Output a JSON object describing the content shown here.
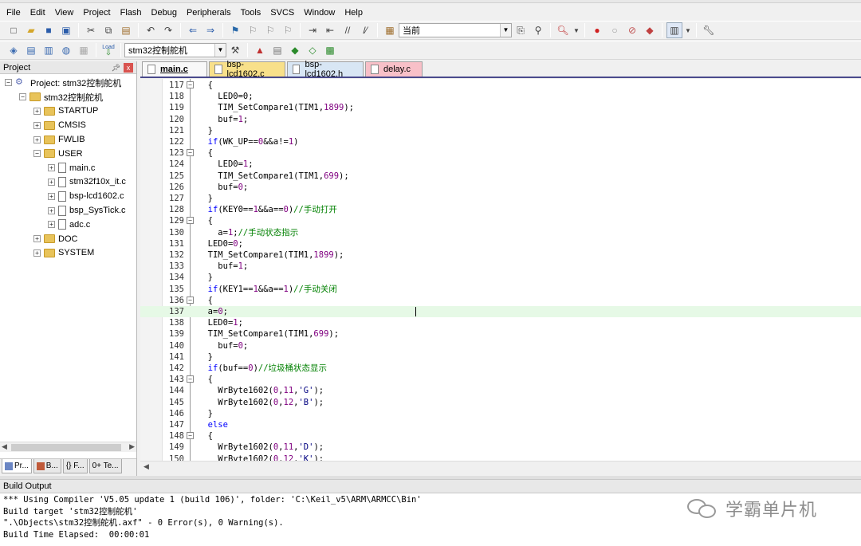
{
  "menu": [
    "File",
    "Edit",
    "View",
    "Project",
    "Flash",
    "Debug",
    "Peripherals",
    "Tools",
    "SVCS",
    "Window",
    "Help"
  ],
  "toolbar1": {
    "find_value": "当前",
    "icons": [
      "new-file-icon",
      "open-folder-icon",
      "save-icon",
      "save-all-icon",
      "cut-icon",
      "copy-icon",
      "paste-icon",
      "undo-icon",
      "redo-icon",
      "nav-back-icon",
      "nav-forward-icon",
      "bookmark-icon",
      "prev-bookmark-icon",
      "next-bookmark-icon",
      "clear-bookmarks-icon",
      "indent-icon",
      "unindent-icon",
      "comment-icon",
      "uncomment-icon",
      "find-in-files-icon"
    ]
  },
  "toolbar2": {
    "load_label": "Load",
    "target_value": "stm32控制舵机"
  },
  "project_panel": {
    "title": "Project",
    "root": "Project: stm32控制舵机",
    "target": "stm32控制舵机",
    "groups": {
      "startup": "STARTUP",
      "cmsis": "CMSIS",
      "fwlib": "FWLIB",
      "user": "USER",
      "doc": "DOC",
      "system": "SYSTEM"
    },
    "files": [
      "main.c",
      "stm32f10x_it.c",
      "bsp-lcd1602.c",
      "bsp_SysTick.c",
      "adc.c"
    ],
    "bottom_tabs": [
      "Pr...",
      "B...",
      "{} F...",
      "0+ Te..."
    ]
  },
  "editor_tabs": [
    "main.c",
    "bsp-lcd1602.c",
    "bsp-lcd1602.h",
    "delay.c"
  ],
  "code_lines": [
    {
      "n": "117",
      "fold": true,
      "ind": "  ",
      "parts": [
        [
          "p",
          "{"
        ]
      ]
    },
    {
      "n": "118",
      "ind": "    ",
      "parts": [
        [
          "p",
          "LED0=0;"
        ]
      ]
    },
    {
      "n": "119",
      "ind": "    ",
      "parts": [
        [
          "p",
          "TIM_SetCompare1(TIM1,"
        ],
        [
          "num",
          "1899"
        ],
        [
          "p",
          ");"
        ]
      ]
    },
    {
      "n": "120",
      "ind": "    ",
      "parts": [
        [
          "p",
          "buf="
        ],
        [
          "num",
          "1"
        ],
        [
          "p",
          ";"
        ]
      ]
    },
    {
      "n": "121",
      "ind": "  ",
      "parts": [
        [
          "p",
          "}"
        ]
      ]
    },
    {
      "n": "122",
      "ind": "  ",
      "parts": [
        [
          "kw",
          "if"
        ],
        [
          "p",
          "(WK_UP=="
        ],
        [
          "num",
          "0"
        ],
        [
          "p",
          "&&a!="
        ],
        [
          "num",
          "1"
        ],
        [
          "p",
          ")"
        ]
      ]
    },
    {
      "n": "123",
      "fold": true,
      "ind": "  ",
      "parts": [
        [
          "p",
          "{"
        ]
      ]
    },
    {
      "n": "124",
      "ind": "    ",
      "parts": [
        [
          "p",
          "LED0="
        ],
        [
          "num",
          "1"
        ],
        [
          "p",
          ";"
        ]
      ]
    },
    {
      "n": "125",
      "ind": "    ",
      "parts": [
        [
          "p",
          "TIM_SetCompare1(TIM1,"
        ],
        [
          "num",
          "699"
        ],
        [
          "p",
          ");"
        ]
      ]
    },
    {
      "n": "126",
      "ind": "    ",
      "parts": [
        [
          "p",
          "buf="
        ],
        [
          "num",
          "0"
        ],
        [
          "p",
          ";"
        ]
      ]
    },
    {
      "n": "127",
      "ind": "  ",
      "parts": [
        [
          "p",
          "}"
        ]
      ]
    },
    {
      "n": "128",
      "ind": "  ",
      "parts": [
        [
          "kw",
          "if"
        ],
        [
          "p",
          "(KEY0=="
        ],
        [
          "num",
          "1"
        ],
        [
          "p",
          "&&a=="
        ],
        [
          "num",
          "0"
        ],
        [
          "p",
          ")"
        ],
        [
          "cm",
          "//手动打开"
        ]
      ]
    },
    {
      "n": "129",
      "fold": true,
      "ind": "  ",
      "parts": [
        [
          "p",
          "{"
        ]
      ]
    },
    {
      "n": "130",
      "ind": "    ",
      "parts": [
        [
          "p",
          "a="
        ],
        [
          "num",
          "1"
        ],
        [
          "p",
          ";"
        ],
        [
          "cm",
          "//手动状态指示"
        ]
      ]
    },
    {
      "n": "131",
      "ind": "  ",
      "parts": [
        [
          "p",
          "LED0="
        ],
        [
          "num",
          "0"
        ],
        [
          "p",
          ";"
        ]
      ]
    },
    {
      "n": "132",
      "ind": "  ",
      "parts": [
        [
          "p",
          "TIM_SetCompare1(TIM1,"
        ],
        [
          "num",
          "1899"
        ],
        [
          "p",
          ");"
        ]
      ]
    },
    {
      "n": "133",
      "ind": "    ",
      "parts": [
        [
          "p",
          "buf="
        ],
        [
          "num",
          "1"
        ],
        [
          "p",
          ";"
        ]
      ]
    },
    {
      "n": "134",
      "ind": "  ",
      "parts": [
        [
          "p",
          "}"
        ]
      ]
    },
    {
      "n": "135",
      "ind": "  ",
      "parts": [
        [
          "kw",
          "if"
        ],
        [
          "p",
          "(KEY1=="
        ],
        [
          "num",
          "1"
        ],
        [
          "p",
          "&&a=="
        ],
        [
          "num",
          "1"
        ],
        [
          "p",
          ")"
        ],
        [
          "cm",
          "//手动关闭"
        ]
      ]
    },
    {
      "n": "136",
      "fold": true,
      "ind": "  ",
      "parts": [
        [
          "p",
          "{"
        ]
      ]
    },
    {
      "n": "137",
      "hl": true,
      "caret": true,
      "ind": "  ",
      "parts": [
        [
          "p",
          "a="
        ],
        [
          "num",
          "0"
        ],
        [
          "p",
          ";"
        ]
      ]
    },
    {
      "n": "138",
      "ind": "  ",
      "parts": [
        [
          "p",
          "LED0="
        ],
        [
          "num",
          "1"
        ],
        [
          "p",
          ";"
        ]
      ]
    },
    {
      "n": "139",
      "ind": "  ",
      "parts": [
        [
          "p",
          "TIM_SetCompare1(TIM1,"
        ],
        [
          "num",
          "699"
        ],
        [
          "p",
          ");"
        ]
      ]
    },
    {
      "n": "140",
      "ind": "    ",
      "parts": [
        [
          "p",
          "buf="
        ],
        [
          "num",
          "0"
        ],
        [
          "p",
          ";"
        ]
      ]
    },
    {
      "n": "141",
      "ind": "  ",
      "parts": [
        [
          "p",
          "}"
        ]
      ]
    },
    {
      "n": "142",
      "ind": "  ",
      "parts": [
        [
          "kw",
          "if"
        ],
        [
          "p",
          "(buf=="
        ],
        [
          "num",
          "0"
        ],
        [
          "p",
          ")"
        ],
        [
          "cm",
          "//垃圾桶状态显示"
        ]
      ]
    },
    {
      "n": "143",
      "fold": true,
      "ind": "  ",
      "parts": [
        [
          "p",
          "{"
        ]
      ]
    },
    {
      "n": "144",
      "ind": "    ",
      "parts": [
        [
          "p",
          "WrByte1602("
        ],
        [
          "num",
          "0"
        ],
        [
          "p",
          ","
        ],
        [
          "num",
          "11"
        ],
        [
          "p",
          ","
        ],
        [
          "st",
          "'G'"
        ],
        [
          "p",
          ");"
        ]
      ]
    },
    {
      "n": "145",
      "ind": "    ",
      "parts": [
        [
          "p",
          "WrByte1602("
        ],
        [
          "num",
          "0"
        ],
        [
          "p",
          ","
        ],
        [
          "num",
          "12"
        ],
        [
          "p",
          ","
        ],
        [
          "st",
          "'B'"
        ],
        [
          "p",
          ");"
        ]
      ]
    },
    {
      "n": "146",
      "ind": "  ",
      "parts": [
        [
          "p",
          "}"
        ]
      ]
    },
    {
      "n": "147",
      "ind": "  ",
      "parts": [
        [
          "kw",
          "else"
        ]
      ]
    },
    {
      "n": "148",
      "fold": true,
      "ind": "  ",
      "parts": [
        [
          "p",
          "{"
        ]
      ]
    },
    {
      "n": "149",
      "ind": "    ",
      "parts": [
        [
          "p",
          "WrByte1602("
        ],
        [
          "num",
          "0"
        ],
        [
          "p",
          ","
        ],
        [
          "num",
          "11"
        ],
        [
          "p",
          ","
        ],
        [
          "st",
          "'D'"
        ],
        [
          "p",
          ");"
        ]
      ]
    },
    {
      "n": "150",
      "ind": "    ",
      "parts": [
        [
          "p",
          "WrByte1602("
        ],
        [
          "num",
          "0"
        ],
        [
          "p",
          ","
        ],
        [
          "num",
          "12"
        ],
        [
          "p",
          ","
        ],
        [
          "st",
          "'K'"
        ],
        [
          "p",
          ");"
        ]
      ]
    }
  ],
  "build": {
    "title": "Build Output",
    "lines": [
      "*** Using Compiler 'V5.05 update 1 (build 106)', folder: 'C:\\Keil_v5\\ARM\\ARMCC\\Bin'",
      "Build target 'stm32控制舵机'",
      "\".\\Objects\\stm32控制舵机.axf\" - 0 Error(s), 0 Warning(s).",
      "Build Time Elapsed:  00:00:01"
    ]
  },
  "watermark": "学霸单片机"
}
